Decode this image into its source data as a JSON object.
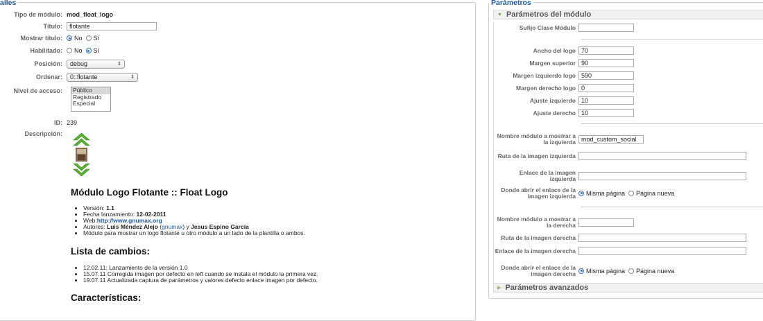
{
  "left": {
    "legend": "alles",
    "fields": {
      "tipo_label": "Tipo de módulo:",
      "tipo_value": "mod_float_logo",
      "titulo_label": "Título:",
      "titulo_value": "flotante",
      "mostrar_label": "Mostrar título:",
      "mostrar_opts": [
        "No",
        "Sí"
      ],
      "habilitado_label": "Habilitado:",
      "habilitado_opts": [
        "No",
        "Sí"
      ],
      "posicion_label": "Posición:",
      "posicion_value": "debug",
      "ordenar_label": "Ordenar:",
      "ordenar_value": "0::flotante",
      "nivel_label": "Nivel de acceso:",
      "nivel_options": [
        "Público",
        "Registrado",
        "Especial"
      ],
      "id_label": "ID:",
      "id_value": "239",
      "descripcion_label": "Descripción:"
    },
    "description": {
      "title": "Módulo Logo Flotante :: Float Logo",
      "bullets": {
        "version_prefix": "Versión: ",
        "version": "1.1",
        "fecha_prefix": "Fecha lanzamiento: ",
        "fecha": "12-02-2011",
        "web_prefix": "Web:",
        "web": "http://www.gnumax.org",
        "autores_prefix": "Autores: ",
        "autor1": "Luis Méndez Alejo",
        "autor1_link": "gnumax",
        "autores_and": " y ",
        "autor2": "Jesus Espino García",
        "modulo": "Módulo para mostrar un logo flotante u otro módulo a un lado de la plantilla o ambos."
      },
      "changes_title": "Lista de cambios:",
      "changes": {
        "c1": "12.02.11: Lanzamiento de la versión 1.0",
        "c2a": "15.07.11 Corregida imagen por defecto en ",
        "c2b": "left",
        "c2c": " cuando se instala el módulo la primera vez.",
        "c3": "19.07.11 Actualizada captura de parámetros y valores defecto enlace imagen por defecto."
      },
      "features_title": "Características:"
    }
  },
  "right": {
    "legend": "Parámetros",
    "module_params_header": "Parámetros del módulo",
    "advanced_header": "Parámetros avanzados",
    "sufijo_label": "Sufijo Clase Módulo",
    "sufijo_value": "",
    "ancho_label": "Ancho del logo",
    "ancho_value": "70",
    "margen_sup_label": "Margen superior",
    "margen_sup_value": "90",
    "margen_izq_label": "Margen izquierdo logo",
    "margen_izq_value": "590",
    "margen_der_label": "Margen derecho logo",
    "margen_der_value": "0",
    "ajuste_izq_label": "Ajuste izquierdo",
    "ajuste_izq_value": "10",
    "ajuste_der_label": "Ajuste derecho",
    "ajuste_der_value": "10",
    "nombre_izq_label": "Nombre módulo a mostrar a la izquierda",
    "nombre_izq_value": "mod_custom_social",
    "ruta_izq_label": "Ruta de la imagen izquierda",
    "ruta_izq_value": "",
    "enlace_izq_label": "Enlace de la imagen izquierda",
    "enlace_izq_value": "",
    "donde_izq_label": "Donde abrir el enlace de la imagen izquierda",
    "nombre_der_label": "Nombre módulo a mostrar a la derecha",
    "nombre_der_value": "",
    "ruta_der_label": "Ruta de la imagen derecha",
    "ruta_der_value": "",
    "enlace_der_label": "Enlace de la imagen derecha",
    "enlace_der_value": "",
    "donde_der_label": "Donde abrir el enlace de la imagen derecha",
    "open_opts": [
      "Misma página",
      "Página nueva"
    ]
  },
  "colors": {
    "legend": "#1f5aa8",
    "accent_green": "#6aa832",
    "link": "#1f5aa8"
  }
}
